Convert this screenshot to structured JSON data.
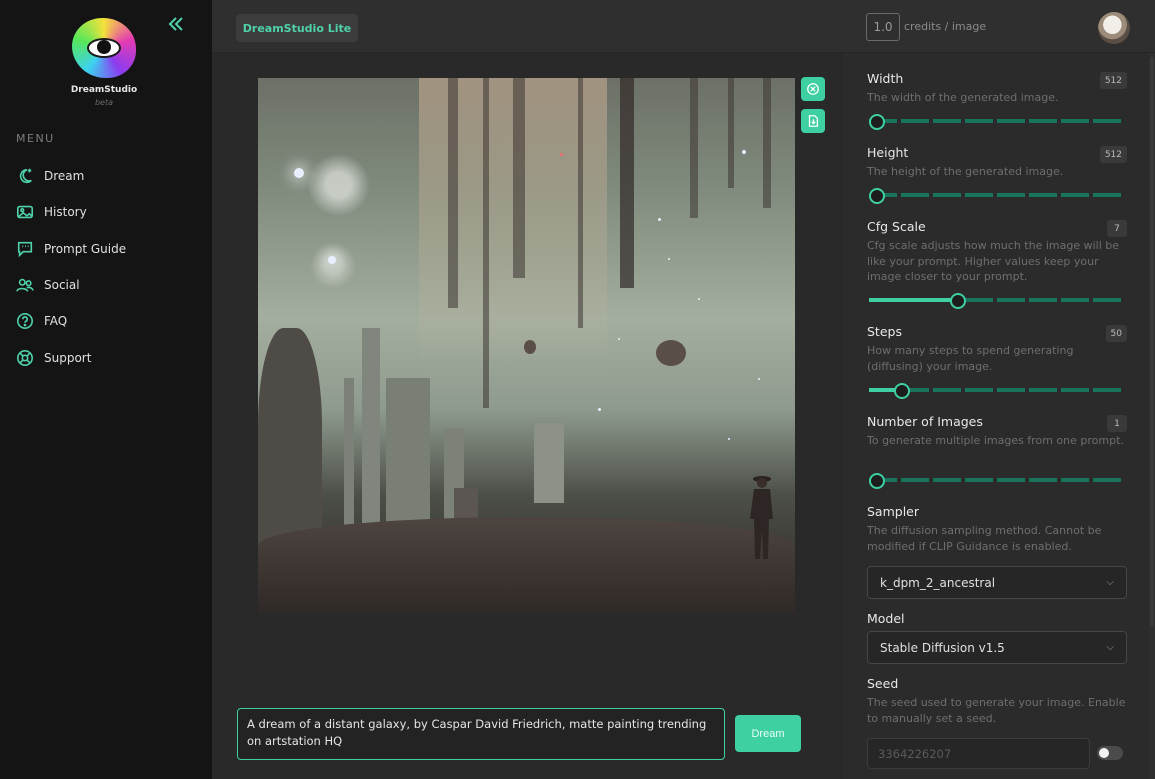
{
  "app": {
    "brand_name": "DreamStudio",
    "brand_tag": "beta",
    "product_tab": "DreamStudio Lite",
    "credits_value": "1.0",
    "credits_label": "credits / image"
  },
  "sidebar": {
    "menu_heading": "MENU",
    "items": [
      {
        "label": "Dream",
        "icon": "moon-star-icon"
      },
      {
        "label": "History",
        "icon": "image-icon"
      },
      {
        "label": "Prompt Guide",
        "icon": "chat-bubble-icon"
      },
      {
        "label": "Social",
        "icon": "users-icon"
      },
      {
        "label": "FAQ",
        "icon": "question-circle-icon"
      },
      {
        "label": "Support",
        "icon": "lifebuoy-icon"
      }
    ]
  },
  "main": {
    "image_tools": [
      "close-circle-icon",
      "download-icon"
    ],
    "prompt": "A dream of a distant galaxy, by Caspar David Friedrich, matte painting trending on artstation HQ",
    "dream_label": "Dream"
  },
  "settings": {
    "width": {
      "title": "Width",
      "value": "512",
      "desc": "The width of the generated image.",
      "level": 0.0
    },
    "height": {
      "title": "Height",
      "value": "512",
      "desc": "The height of the generated image.",
      "level": 0.0
    },
    "cfg": {
      "title": "Cfg Scale",
      "value": "7",
      "desc": "Cfg scale adjusts how much the image will be like your prompt. Higher values keep your image closer to your prompt.",
      "level": 0.35
    },
    "steps": {
      "title": "Steps",
      "value": "50",
      "desc": "How many steps to spend generating (diffusing) your image.",
      "level": 0.13
    },
    "num_images": {
      "title": "Number of Images",
      "value": "1",
      "desc": "To generate multiple images from one prompt.",
      "level": 0.0
    },
    "sampler": {
      "title": "Sampler",
      "desc": "The diffusion sampling method. Cannot be modified if CLIP Guidance is enabled.",
      "value": "k_dpm_2_ancestral"
    },
    "model": {
      "title": "Model",
      "value": "Stable Diffusion v1.5"
    },
    "seed": {
      "title": "Seed",
      "desc": "The seed used to generate your image. Enable to manually set a seed.",
      "value": "3364226207",
      "enabled": false
    }
  },
  "colors": {
    "accent": "#3ecfa3",
    "sidebar_bg": "#141414",
    "panel_bg": "#2b2b2b"
  }
}
